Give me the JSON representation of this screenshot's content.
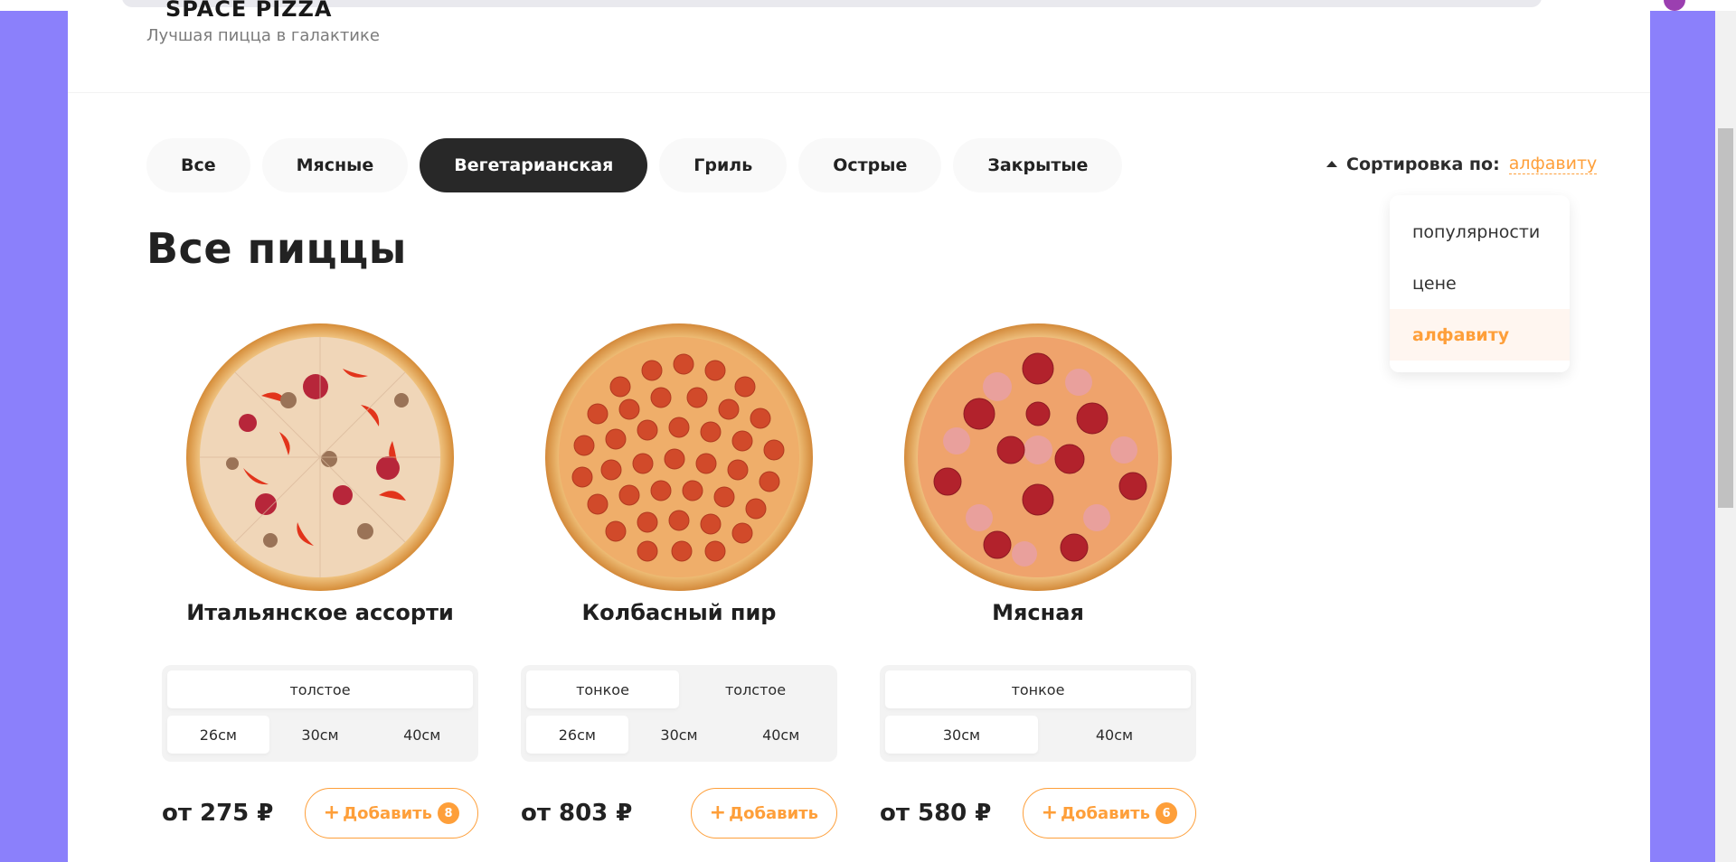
{
  "header": {
    "logo": "SPACE PIZZA",
    "tagline": "Лучшая пицца в галактике"
  },
  "categories": [
    "Все",
    "Мясные",
    "Вегетарианская",
    "Гриль",
    "Острые",
    "Закрытые"
  ],
  "active_category": "Вегетарианская",
  "sort": {
    "label": "Сортировка по:",
    "value": "алфавиту",
    "options": [
      "популярности",
      "цене",
      "алфавиту"
    ]
  },
  "section_title": "Все пиццы",
  "pizzas": [
    {
      "name": "Итальянское ассорти",
      "doughs": [
        "толстое"
      ],
      "sizes": [
        "26см",
        "30см",
        "40см"
      ],
      "price": "от 275 ₽",
      "add_label": "Добавить",
      "count": "8"
    },
    {
      "name": "Колбасный пир",
      "doughs": [
        "тонкое",
        "толстое"
      ],
      "sizes": [
        "26см",
        "30см",
        "40см"
      ],
      "price": "от 803 ₽",
      "add_label": "Добавить",
      "count": ""
    },
    {
      "name": "Мясная",
      "doughs": [
        "тонкое"
      ],
      "sizes": [
        "30см",
        "40см"
      ],
      "price": "от 580 ₽",
      "add_label": "Добавить",
      "count": "6"
    }
  ],
  "colors": {
    "accent": "#fe9f3a",
    "background": "#8b80fb",
    "active_pill": "#282828"
  }
}
